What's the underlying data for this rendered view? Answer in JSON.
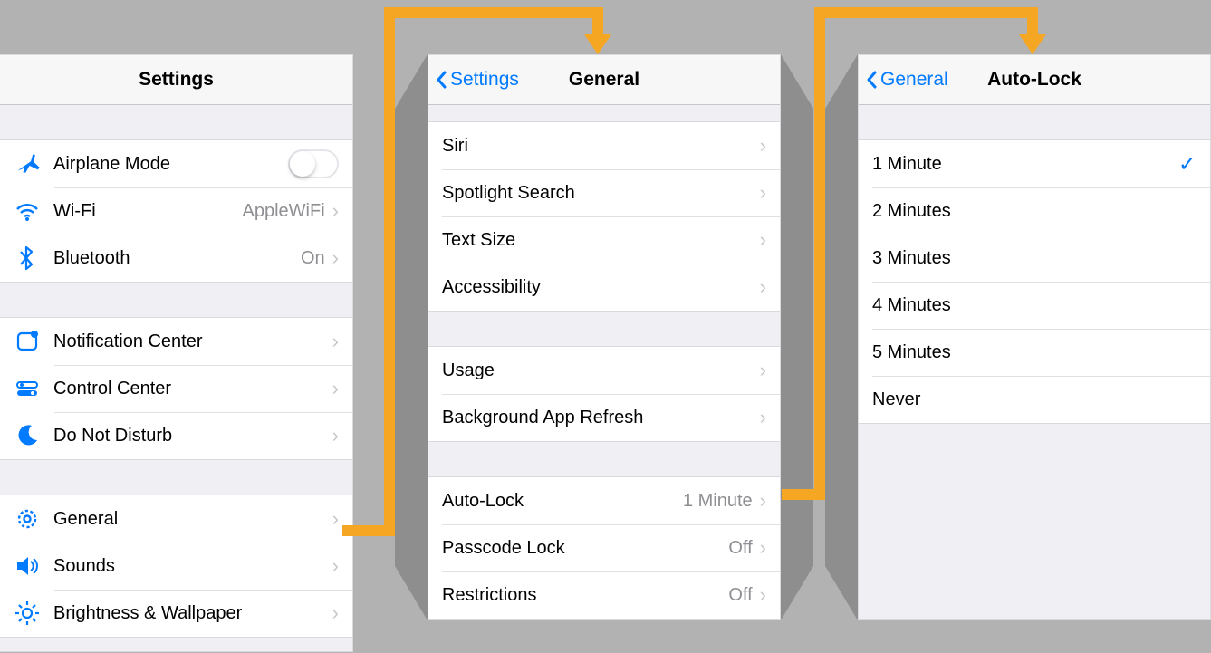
{
  "accent": "#007aff",
  "arrow_color": "#f5a623",
  "panel1": {
    "title": "Settings",
    "group1": [
      {
        "icon": "airplane",
        "label": "Airplane Mode",
        "type": "toggle",
        "on": false
      },
      {
        "icon": "wifi",
        "label": "Wi-Fi",
        "detail": "AppleWiFi",
        "type": "nav"
      },
      {
        "icon": "bluetooth",
        "label": "Bluetooth",
        "detail": "On",
        "type": "nav"
      }
    ],
    "group2": [
      {
        "icon": "notification",
        "label": "Notification Center",
        "type": "nav"
      },
      {
        "icon": "control",
        "label": "Control Center",
        "type": "nav"
      },
      {
        "icon": "dnd",
        "label": "Do Not Disturb",
        "type": "nav"
      }
    ],
    "group3": [
      {
        "icon": "general",
        "label": "General",
        "type": "nav"
      },
      {
        "icon": "sounds",
        "label": "Sounds",
        "type": "nav"
      },
      {
        "icon": "brightness",
        "label": "Brightness & Wallpaper",
        "type": "nav"
      }
    ]
  },
  "panel2": {
    "back": "Settings",
    "title": "General",
    "group1": [
      {
        "label": "Siri",
        "type": "nav"
      },
      {
        "label": "Spotlight Search",
        "type": "nav"
      },
      {
        "label": "Text Size",
        "type": "nav"
      },
      {
        "label": "Accessibility",
        "type": "nav"
      }
    ],
    "group2": [
      {
        "label": "Usage",
        "type": "nav"
      },
      {
        "label": "Background App Refresh",
        "type": "nav"
      }
    ],
    "group3": [
      {
        "label": "Auto-Lock",
        "detail": "1 Minute",
        "type": "nav"
      },
      {
        "label": "Passcode Lock",
        "detail": "Off",
        "type": "nav"
      },
      {
        "label": "Restrictions",
        "detail": "Off",
        "type": "nav"
      }
    ]
  },
  "panel3": {
    "back": "General",
    "title": "Auto-Lock",
    "options": [
      {
        "label": "1 Minute",
        "selected": true
      },
      {
        "label": "2 Minutes",
        "selected": false
      },
      {
        "label": "3 Minutes",
        "selected": false
      },
      {
        "label": "4 Minutes",
        "selected": false
      },
      {
        "label": "5 Minutes",
        "selected": false
      },
      {
        "label": "Never",
        "selected": false
      }
    ]
  }
}
